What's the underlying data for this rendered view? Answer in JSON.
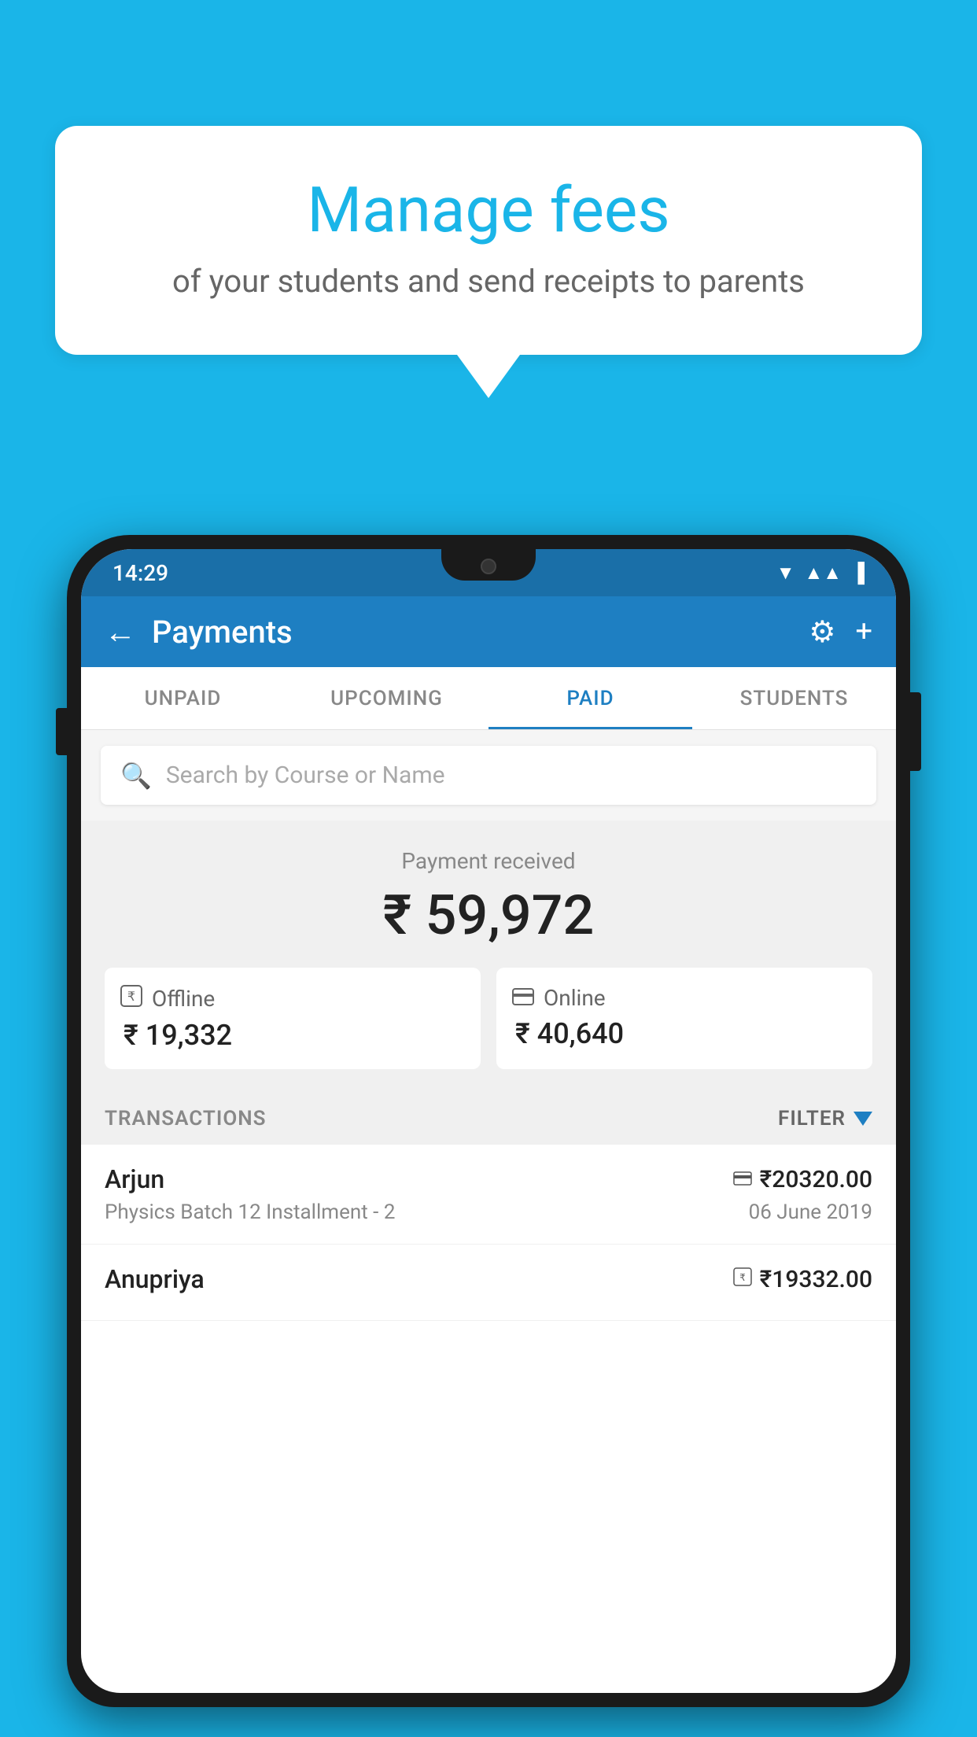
{
  "background_color": "#1ab5e8",
  "speech_bubble": {
    "title": "Manage fees",
    "subtitle": "of your students and send receipts to parents"
  },
  "status_bar": {
    "time": "14:29",
    "wifi": "▲",
    "signal": "▲",
    "battery": "▐"
  },
  "header": {
    "title": "Payments",
    "back_label": "←",
    "gear_label": "⚙",
    "plus_label": "+"
  },
  "tabs": [
    {
      "label": "UNPAID",
      "active": false
    },
    {
      "label": "UPCOMING",
      "active": false
    },
    {
      "label": "PAID",
      "active": true
    },
    {
      "label": "STUDENTS",
      "active": false
    }
  ],
  "search": {
    "placeholder": "Search by Course or Name"
  },
  "payment_received": {
    "label": "Payment received",
    "amount": "₹ 59,972",
    "offline": {
      "icon": "rupee-box",
      "label": "Offline",
      "amount": "₹ 19,332"
    },
    "online": {
      "icon": "card",
      "label": "Online",
      "amount": "₹ 40,640"
    }
  },
  "transactions_section": {
    "label": "TRANSACTIONS",
    "filter_label": "FILTER"
  },
  "transactions": [
    {
      "name": "Arjun",
      "course": "Physics Batch 12 Installment - 2",
      "amount": "₹20320.00",
      "date": "06 June 2019",
      "method": "card"
    },
    {
      "name": "Anupriya",
      "course": "",
      "amount": "₹19332.00",
      "date": "",
      "method": "rupee-box"
    }
  ]
}
